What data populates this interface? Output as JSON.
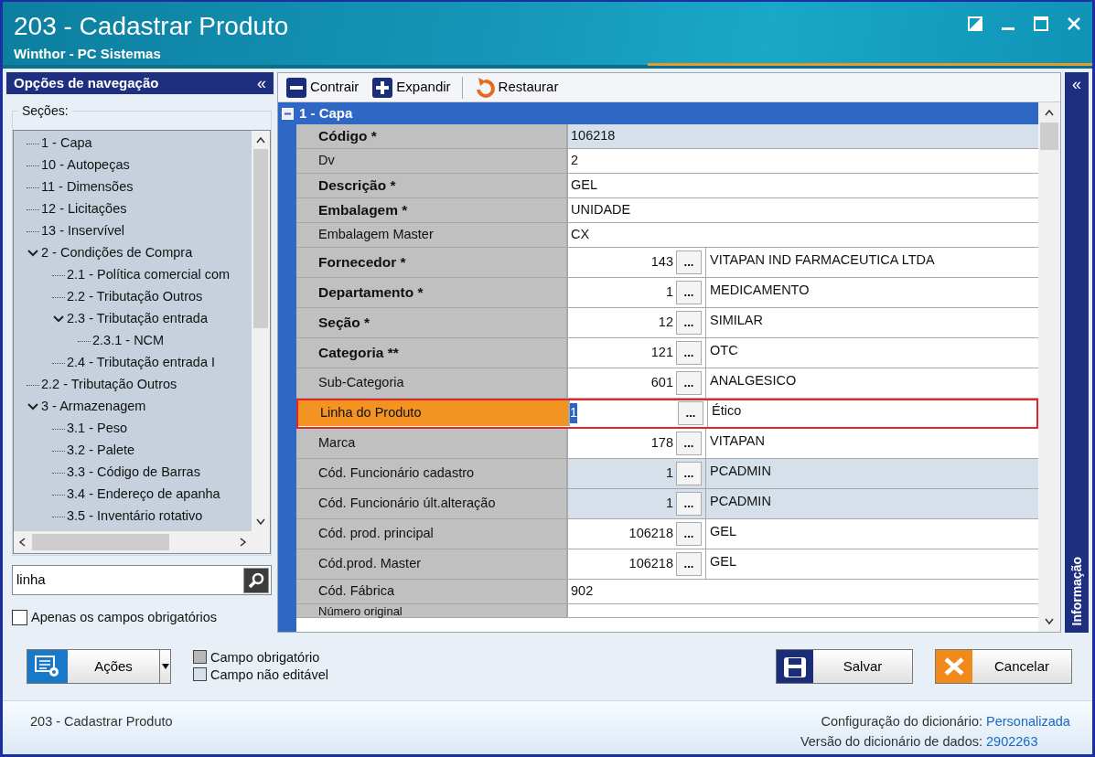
{
  "window": {
    "title": "203 - Cadastrar  Produto",
    "subtitle": "Winthor - PC Sistemas"
  },
  "navigation": {
    "title": "Opções de navegação",
    "collapse": "«",
    "sections_label": "Seções:",
    "tree": [
      {
        "label": "1 - Capa"
      },
      {
        "label": "10 - Autopeças"
      },
      {
        "label": "11 - Dimensões"
      },
      {
        "label": "12 - Licitações"
      },
      {
        "label": "13 - Inservível"
      },
      {
        "label": "2 - Condições de Compra",
        "expanded": true,
        "children": [
          {
            "label": "2.1 - Política comercial com"
          },
          {
            "label": "2.2 - Tributação Outros"
          },
          {
            "label": "2.3 - Tributação entrada",
            "expanded": true,
            "children": [
              {
                "label": "2.3.1 - NCM"
              }
            ]
          },
          {
            "label": "2.4 - Tributação entrada I"
          }
        ]
      },
      {
        "label": "2.2 - Tributação Outros"
      },
      {
        "label": "3 - Armazenagem",
        "expanded": true,
        "children": [
          {
            "label": "3.1 - Peso"
          },
          {
            "label": "3.2 - Palete"
          },
          {
            "label": "3.3 - Código de Barras"
          },
          {
            "label": "3.4 - Endereço de apanha"
          },
          {
            "label": "3.5 - Inventário rotativo"
          }
        ]
      }
    ],
    "search": {
      "value": "linha"
    },
    "required_only": {
      "label": "Apenas os campos obrigatórios",
      "checked": false
    }
  },
  "toolbar": [
    {
      "kind": "collapse",
      "label": "Contrair"
    },
    {
      "kind": "expand",
      "label": "Expandir"
    },
    {
      "kind": "restore",
      "label": "Restaurar"
    }
  ],
  "group": {
    "title": "1 - Capa",
    "expanded": true,
    "rows": [
      {
        "label": "Código *",
        "required": true,
        "kind": "text",
        "value": "106218",
        "editable": false,
        "selected": false
      },
      {
        "label": "Dv",
        "required": false,
        "kind": "text",
        "value": "2",
        "editable": true,
        "selected": false
      },
      {
        "label": "Descrição *",
        "required": true,
        "kind": "text",
        "value": "GEL",
        "editable": true,
        "selected": false
      },
      {
        "label": "Embalagem *",
        "required": true,
        "kind": "text",
        "value": "UNIDADE",
        "editable": true,
        "selected": false
      },
      {
        "label": "Embalagem Master",
        "required": false,
        "kind": "text",
        "value": "CX",
        "editable": true,
        "selected": false
      },
      {
        "label": "Fornecedor *",
        "required": true,
        "kind": "lookup",
        "value": "143",
        "button": "...",
        "description": "VITAPAN IND FARMACEUTICA LTDA",
        "editable": true,
        "selected": false
      },
      {
        "label": "Departamento *",
        "required": true,
        "kind": "lookup",
        "value": "1",
        "button": "...",
        "description": "MEDICAMENTO",
        "editable": true,
        "selected": false
      },
      {
        "label": "Seção *",
        "required": true,
        "kind": "lookup",
        "value": "12",
        "button": "...",
        "description": "SIMILAR",
        "editable": true,
        "selected": false
      },
      {
        "label": "Categoria **",
        "required": true,
        "kind": "lookup",
        "value": "121",
        "button": "...",
        "description": "OTC",
        "editable": true,
        "selected": false
      },
      {
        "label": "Sub-Categoria",
        "required": false,
        "kind": "lookup",
        "value": "601",
        "button": "...",
        "description": "ANALGESICO",
        "editable": true,
        "selected": false
      },
      {
        "label": "Linha do Produto",
        "required": false,
        "kind": "lookup",
        "value": "1",
        "button": "...",
        "description": "Ético",
        "editable": true,
        "selected": true
      },
      {
        "label": "Marca",
        "required": false,
        "kind": "lookup",
        "value": "178",
        "button": "...",
        "description": "VITAPAN",
        "editable": true,
        "selected": false
      },
      {
        "label": "Cód. Funcionário cadastro",
        "required": false,
        "kind": "lookup",
        "value": "1",
        "button": "...",
        "description": "PCADMIN",
        "editable": false,
        "selected": false
      },
      {
        "label": "Cód. Funcionário últ.alteração",
        "required": false,
        "kind": "lookup",
        "value": "1",
        "button": "...",
        "description": "PCADMIN",
        "editable": false,
        "selected": false
      },
      {
        "label": "Cód. prod. principal",
        "required": false,
        "kind": "lookup",
        "value": "106218",
        "button": "...",
        "description": "GEL",
        "editable": true,
        "selected": false
      },
      {
        "label": "Cód.prod. Master",
        "required": false,
        "kind": "lookup",
        "value": "106218",
        "button": "...",
        "description": "GEL",
        "editable": true,
        "selected": false
      },
      {
        "label": "Cód. Fábrica",
        "required": false,
        "kind": "text",
        "value": "902",
        "editable": true,
        "selected": false
      },
      {
        "label": "Número original",
        "required": false,
        "kind": "partial",
        "editable": true,
        "selected": false
      }
    ]
  },
  "info_panel": {
    "collapse": "«",
    "title": "Informação"
  },
  "actions_button": "Ações",
  "legend": [
    {
      "kind": "required",
      "label": "Campo obrigatório"
    },
    {
      "kind": "readonly",
      "label": "Campo não editável"
    }
  ],
  "buttons": [
    {
      "kind": "save",
      "label": "Salvar"
    },
    {
      "kind": "cancel",
      "label": "Cancelar"
    }
  ],
  "footer": {
    "screen": "203 - Cadastrar  Produto",
    "info": [
      {
        "label": "Configuração do dicionário:",
        "value": "Personalizada"
      },
      {
        "label": "Versão do dicionário de dados:",
        "value": "2902263"
      }
    ]
  }
}
